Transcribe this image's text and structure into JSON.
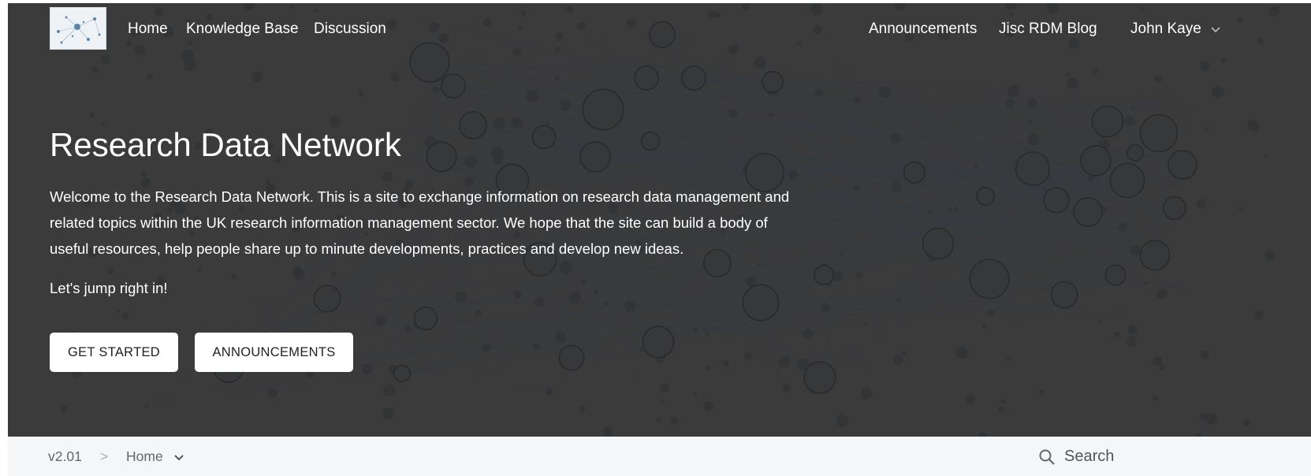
{
  "header": {
    "logo_icon": "network-graph-logo",
    "nav_left": [
      "Home",
      "Knowledge Base",
      "Discussion"
    ],
    "nav_right": [
      "Announcements",
      "Jisc RDM Blog"
    ],
    "user_name": "John Kaye",
    "user_menu_icon": "chevron-down-icon"
  },
  "hero": {
    "title": "Research Data Network",
    "description": "Welcome to the Research Data Network. This is a site to exchange information on research data management and related topics within the UK research information management sector. We hope that the site can build a body of useful resources, help people share up to minute developments, practices and develop new ideas.",
    "cta_text": "Let's jump right in!",
    "buttons": [
      "GET STARTED",
      "ANNOUNCEMENTS"
    ]
  },
  "subbar": {
    "version": "v2.01",
    "separator": ">",
    "current_page": "Home",
    "search_placeholder": "Search"
  },
  "colors": {
    "hero_background": "#3b3b3b",
    "network_nodes": "#2a2e33",
    "subbar_background": "#f5f6f7",
    "button_background": "#ffffff"
  }
}
